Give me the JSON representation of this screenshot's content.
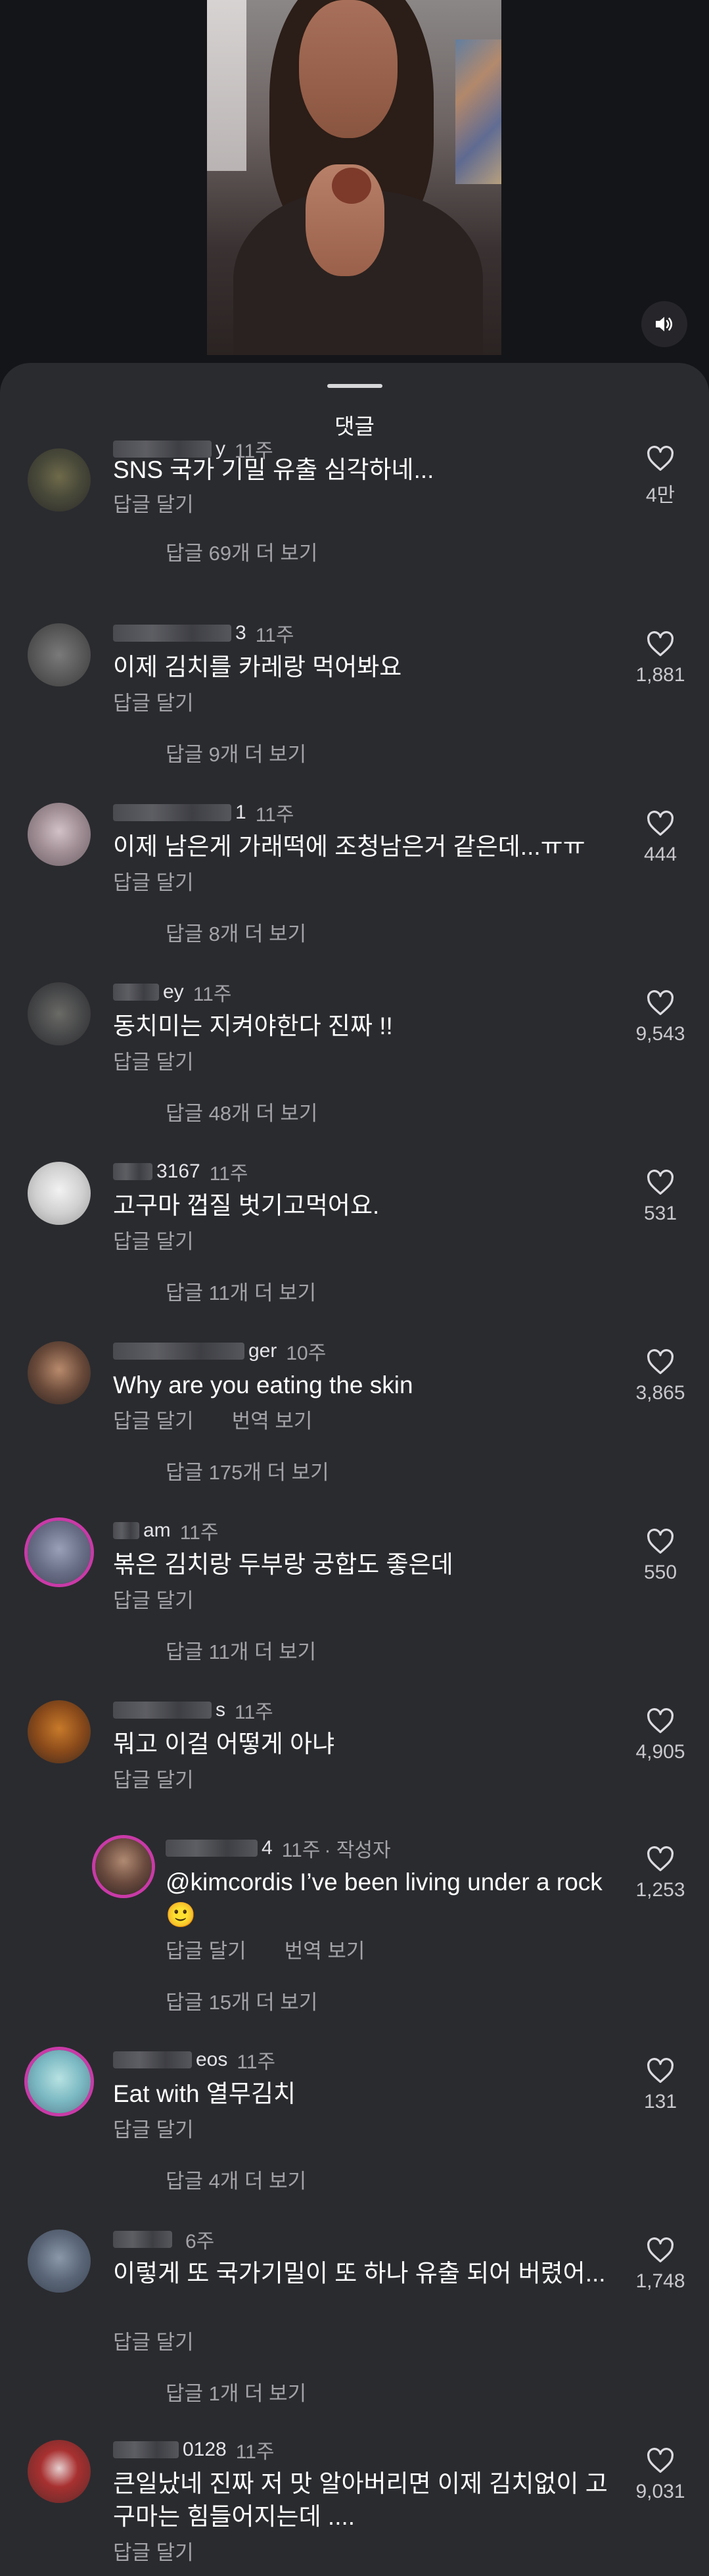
{
  "sheet": {
    "title": "댓글"
  },
  "labels": {
    "reply": "답글 달기",
    "translate": "번역 보기",
    "author_tag": "· 작성자"
  },
  "colors": {
    "sheet_bg": "#2a2b2f",
    "page_bg": "#141518",
    "muted_text": "#a3a3a8",
    "story_ring": "#c93aa7"
  },
  "icons": {
    "volume": "speaker-icon",
    "like": "heart-outline-icon"
  },
  "comments": [
    {
      "name_tail": "y",
      "time": "11주",
      "text": "SNS 국가 기밀 유출 심각하네...",
      "likes": "4만",
      "view_more": "답글 69개 더 보기"
    },
    {
      "name_tail": "3",
      "time": "11주",
      "text": "이제 김치를 카레랑 먹어봐요",
      "likes": "1,881",
      "view_more": "답글 9개 더 보기"
    },
    {
      "name_tail": "1",
      "time": "11주",
      "text": "이제 남은게 가래떡에 조청남은거 같은데...ㅠㅠ",
      "likes": "444",
      "view_more": "답글 8개 더 보기"
    },
    {
      "name_tail": "ey",
      "time": "11주",
      "text": "동치미는 지켜야한다 진짜 !!",
      "likes": "9,543",
      "view_more": "답글 48개 더 보기"
    },
    {
      "name_tail": "3167",
      "time": "11주",
      "text": "고구마 껍질 벗기고먹어요.",
      "likes": "531",
      "view_more": "답글 11개 더 보기"
    },
    {
      "name_tail": "ger",
      "time": "10주",
      "text": "Why are you eating the skin",
      "likes": "3,865",
      "view_more": "답글 175개 더 보기"
    },
    {
      "name_tail": "am",
      "time": "11주",
      "text": "볶은 김치랑 두부랑 궁합도 좋은데",
      "likes": "550",
      "view_more": "답글 11개 더 보기"
    },
    {
      "name_tail": "s",
      "time": "11주",
      "text": "뭐고 이걸 어떻게 아냐",
      "likes": "4,905",
      "view_more": ""
    },
    {
      "name_tail": "4",
      "time": "11주",
      "text": "@kimcordis I’ve been living under a rock 🙂",
      "likes": "1,253",
      "view_more": "답글 15개 더 보기"
    },
    {
      "name_tail": "eos",
      "time": "11주",
      "text": "Eat with 열무김치",
      "likes": "131",
      "view_more": "답글 4개 더 보기"
    },
    {
      "name_tail": "",
      "time": "6주",
      "text": "이렇게 또 국가기밀이 또 하나 유출 되어 버렸어...",
      "likes": "1,748",
      "view_more": "답글 1개 더 보기"
    },
    {
      "name_tail": "0128",
      "time": "11주",
      "text": "큰일났네 진짜 저 맛 알아버리면 이제 김치없이 고구마는 힘들어지는데 ....",
      "likes": "9,031",
      "view_more": ""
    }
  ]
}
